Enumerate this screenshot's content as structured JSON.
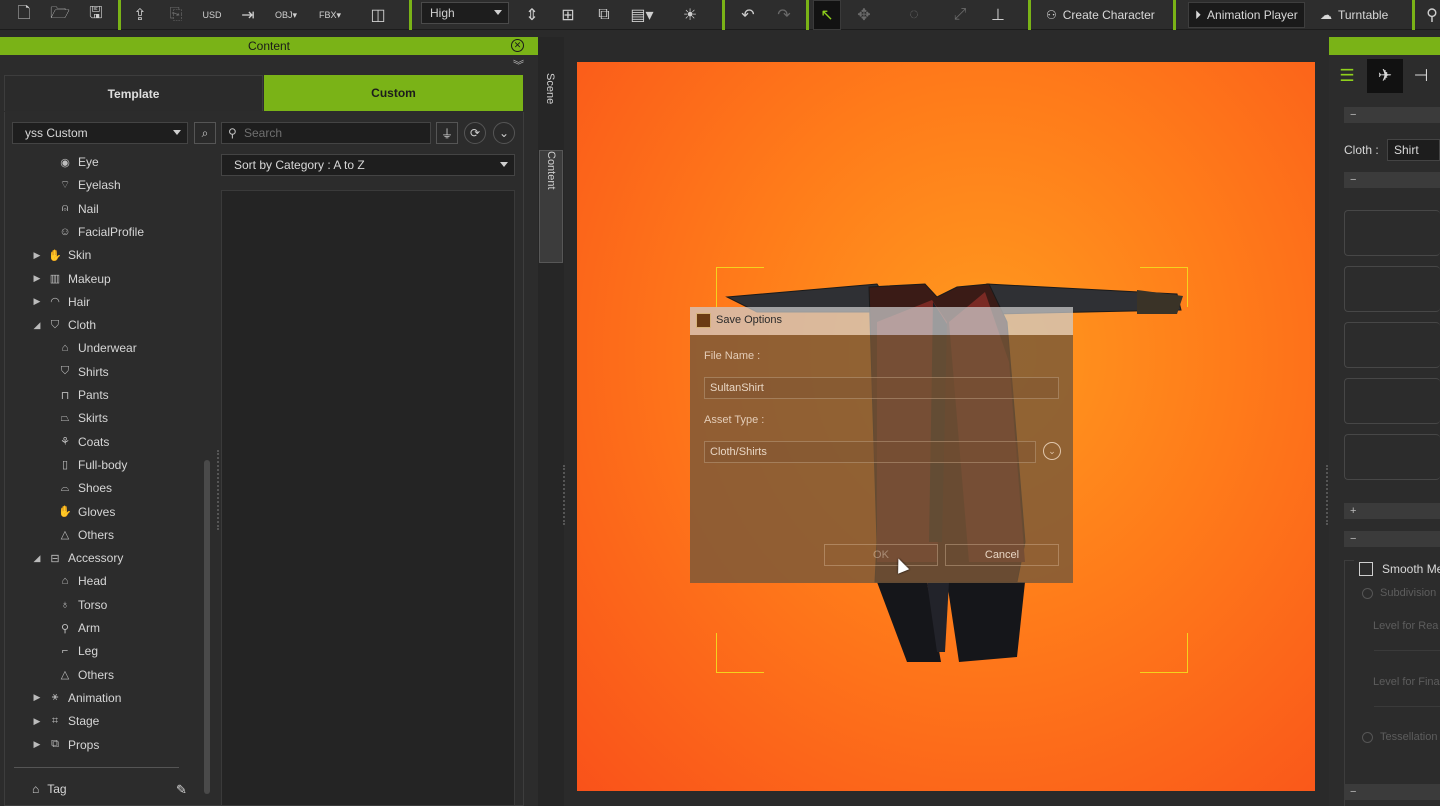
{
  "toolbar": {
    "quality": "High",
    "create_character": "Create Character",
    "animation_player": "Animation Player",
    "turntable": "Turntable"
  },
  "content_panel": {
    "title": "Content",
    "tabs": {
      "template": "Template",
      "custom": "Custom"
    },
    "library_select": "yss Custom",
    "search_placeholder": "Search",
    "sort": "Sort by Category : A to Z",
    "tree": [
      {
        "label": "Eye",
        "level": 2,
        "icon": "eye-icon"
      },
      {
        "label": "Eyelash",
        "level": 2,
        "icon": "eyelash-icon"
      },
      {
        "label": "Nail",
        "level": 2,
        "icon": "nail-icon"
      },
      {
        "label": "FacialProfile",
        "level": 2,
        "icon": "facial-profile-icon"
      },
      {
        "label": "Skin",
        "level": 1,
        "icon": "skin-icon",
        "state": "collapsed"
      },
      {
        "label": "Makeup",
        "level": 1,
        "icon": "makeup-icon",
        "state": "collapsed"
      },
      {
        "label": "Hair",
        "level": 1,
        "icon": "hair-icon",
        "state": "collapsed"
      },
      {
        "label": "Cloth",
        "level": 1,
        "icon": "cloth-icon",
        "state": "expanded"
      },
      {
        "label": "Underwear",
        "level": 2,
        "icon": "underwear-icon"
      },
      {
        "label": "Shirts",
        "level": 2,
        "icon": "shirt-icon"
      },
      {
        "label": "Pants",
        "level": 2,
        "icon": "pants-icon"
      },
      {
        "label": "Skirts",
        "level": 2,
        "icon": "skirt-icon"
      },
      {
        "label": "Coats",
        "level": 2,
        "icon": "coat-icon"
      },
      {
        "label": "Full-body",
        "level": 2,
        "icon": "full-body-icon"
      },
      {
        "label": "Shoes",
        "level": 2,
        "icon": "shoe-icon"
      },
      {
        "label": "Gloves",
        "level": 2,
        "icon": "glove-icon"
      },
      {
        "label": "Others",
        "level": 2,
        "icon": "hanger-icon"
      },
      {
        "label": "Accessory",
        "level": 1,
        "icon": "accessory-icon",
        "state": "expanded"
      },
      {
        "label": "Head",
        "level": 2,
        "icon": "head-accessory-icon"
      },
      {
        "label": "Torso",
        "level": 2,
        "icon": "torso-accessory-icon"
      },
      {
        "label": "Arm",
        "level": 2,
        "icon": "arm-accessory-icon"
      },
      {
        "label": "Leg",
        "level": 2,
        "icon": "leg-accessory-icon"
      },
      {
        "label": "Others",
        "level": 2,
        "icon": "hanger-icon"
      },
      {
        "label": "Animation",
        "level": 1,
        "icon": "animation-icon",
        "state": "collapsed"
      },
      {
        "label": "Stage",
        "level": 1,
        "icon": "stage-icon",
        "state": "collapsed"
      },
      {
        "label": "Props",
        "level": 1,
        "icon": "props-icon",
        "state": "collapsed"
      }
    ],
    "tag_label": "Tag"
  },
  "side_tabs": {
    "scene": "Scene",
    "content": "Content"
  },
  "dialog": {
    "title": "Save Options",
    "file_name_label": "File Name :",
    "file_name_value": "SultanShirt",
    "asset_type_label": "Asset Type :",
    "asset_type_value": "Cloth/Shirts",
    "ok": "OK",
    "cancel": "Cancel"
  },
  "right_panel": {
    "cloth_label": "Cloth :",
    "cloth_value": "Shirt",
    "smooth_mesh": "Smooth Me",
    "subdivision": "Subdivision",
    "level_realtime": "Level for Rea",
    "level_final": "Level for Fina",
    "tessellation": "Tessellation"
  },
  "colors": {
    "accent": "#7ab317",
    "viewport_center": "#ff9a1e",
    "viewport_edge": "#f9521a",
    "bounding_box": "#f4d21e"
  }
}
